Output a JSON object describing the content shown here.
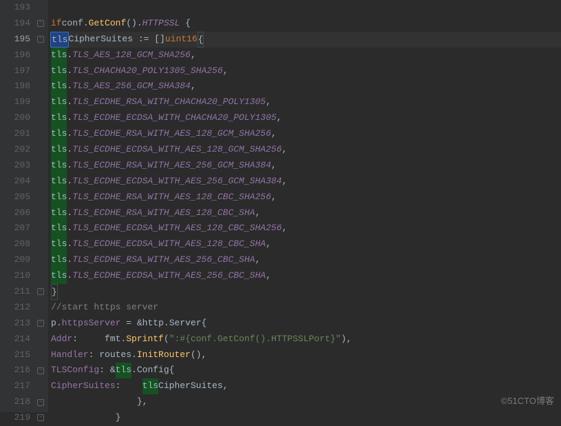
{
  "lines": [
    {
      "num": "193",
      "fold": "",
      "html": ""
    },
    {
      "num": "194",
      "fold": "▾",
      "html": "        <span class='kw'>if</span> <span class='ident'>conf</span>.<span class='func'>GetConf</span>().<span class='field-italic'>HTTPSSL</span> {"
    },
    {
      "num": "195",
      "fold": "▾",
      "current": true,
      "html": "            <span class='hl'>tls</span><span class='ident'>CipherSuites</span> := []<span class='type'>uint16</span><span class='current-brace-match'>{</span>"
    },
    {
      "num": "196",
      "fold": "",
      "html": "                <span class='hl-box'>tls</span>.<span class='const'>TLS_AES_128_GCM_SHA256</span>,"
    },
    {
      "num": "197",
      "fold": "",
      "html": "                <span class='hl-box'>tls</span>.<span class='const'>TLS_CHACHA20_POLY1305_SHA256</span>,"
    },
    {
      "num": "198",
      "fold": "",
      "html": "                <span class='hl-box'>tls</span>.<span class='const'>TLS_AES_256_GCM_SHA384</span>,"
    },
    {
      "num": "199",
      "fold": "",
      "html": "                <span class='hl-box'>tls</span>.<span class='const'>TLS_ECDHE_RSA_WITH_CHACHA20_POLY1305</span>,"
    },
    {
      "num": "200",
      "fold": "",
      "html": "                <span class='hl-box'>tls</span>.<span class='const'>TLS_ECDHE_ECDSA_WITH_CHACHA20_POLY1305</span>,"
    },
    {
      "num": "201",
      "fold": "",
      "html": "                <span class='hl-box'>tls</span>.<span class='const'>TLS_ECDHE_RSA_WITH_AES_128_GCM_SHA256</span>,"
    },
    {
      "num": "202",
      "fold": "",
      "html": "                <span class='hl-box'>tls</span>.<span class='const'>TLS_ECDHE_ECDSA_WITH_AES_128_GCM_SHA256</span>,"
    },
    {
      "num": "203",
      "fold": "",
      "html": "                <span class='hl-box'>tls</span>.<span class='const'>TLS_ECDHE_RSA_WITH_AES_256_GCM_SHA384</span>,"
    },
    {
      "num": "204",
      "fold": "",
      "html": "                <span class='hl-box'>tls</span>.<span class='const'>TLS_ECDHE_ECDSA_WITH_AES_256_GCM_SHA384</span>,"
    },
    {
      "num": "205",
      "fold": "",
      "html": "                <span class='hl-box'>tls</span>.<span class='const'>TLS_ECDHE_RSA_WITH_AES_128_CBC_SHA256</span>,"
    },
    {
      "num": "206",
      "fold": "",
      "html": "                <span class='hl-box'>tls</span>.<span class='const'>TLS_ECDHE_RSA_WITH_AES_128_CBC_SHA</span>,"
    },
    {
      "num": "207",
      "fold": "",
      "html": "                <span class='hl-box'>tls</span>.<span class='const'>TLS_ECDHE_ECDSA_WITH_AES_128_CBC_SHA256</span>,"
    },
    {
      "num": "208",
      "fold": "",
      "html": "                <span class='hl-box'>tls</span>.<span class='const'>TLS_ECDHE_ECDSA_WITH_AES_128_CBC_SHA</span>,"
    },
    {
      "num": "209",
      "fold": "",
      "html": "                <span class='hl-box'>tls</span>.<span class='const'>TLS_ECDHE_RSA_WITH_AES_256_CBC_SHA</span>,"
    },
    {
      "num": "210",
      "fold": "",
      "html": "                <span class='hl-box'>tls</span>.<span class='const'>TLS_ECDHE_ECDSA_WITH_AES_256_CBC_SHA</span>,"
    },
    {
      "num": "211",
      "fold": "▴",
      "html": "            <span class='current-brace-match'>}</span>"
    },
    {
      "num": "212",
      "fold": "",
      "html": "            <span class='comment'>//start https server</span>"
    },
    {
      "num": "213",
      "fold": "▾",
      "html": "            <span class='ident'>p</span>.<span class='field'>httpsServer</span> = &amp;<span class='ident'>http</span>.<span class='ident'>Server</span>{"
    },
    {
      "num": "214",
      "fold": "",
      "html": "                <span class='field'>Addr</span>:     <span class='ident'>fmt</span>.<span class='func'>Sprintf</span>(<span class='str'>\":#{conf.GetConf().HTTPSSLPort}\"</span>),"
    },
    {
      "num": "215",
      "fold": "",
      "html": "                <span class='field'>Handler</span>: <span class='ident'>routes</span>.<span class='func'>InitRouter</span>(),"
    },
    {
      "num": "216",
      "fold": "▾",
      "html": "                <span class='field'>TLSConfig</span>: &amp;<span class='hl-box'>tls</span>.<span class='ident'>Config</span>{"
    },
    {
      "num": "217",
      "fold": "",
      "html": "                    <span class='field'>CipherSuites</span>:    <span class='hl-box'>tls</span><span class='ident'>CipherSuites</span>,"
    },
    {
      "num": "218",
      "fold": "▴",
      "html": "                },"
    },
    {
      "num": "219",
      "fold": "▴",
      "html": "            }"
    }
  ],
  "watermark": "©51CTO博客"
}
